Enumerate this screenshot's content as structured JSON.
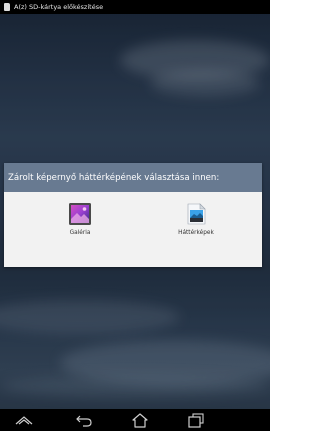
{
  "status_bar": {
    "notification_text": "A(z) SD-kártya előkészítése",
    "icon": "sd-card-icon"
  },
  "dialog": {
    "title": "Zárolt képernyő háttérképének választása innen:",
    "options": [
      {
        "label": "Galéria",
        "icon": "gallery-icon"
      },
      {
        "label": "Háttérképek",
        "icon": "wallpapers-icon"
      }
    ]
  },
  "nav_bar": {
    "buttons": [
      "up-icon",
      "back-icon",
      "home-icon",
      "recents-icon"
    ]
  },
  "colors": {
    "dialog_header": "#687a91",
    "dialog_body": "#f2f2f2",
    "status_bar": "#000000",
    "nav_bar": "#000000"
  }
}
